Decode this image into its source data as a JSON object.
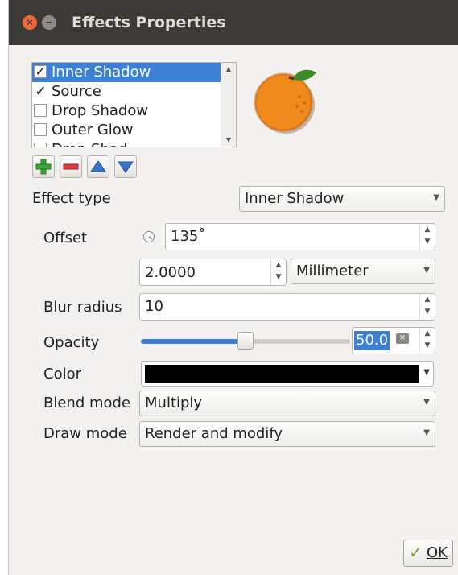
{
  "dialog": {
    "title": "Effects Properties"
  },
  "effects_list": {
    "items": [
      {
        "label": "Inner Shadow",
        "checked": true,
        "selected": true
      },
      {
        "label": "Source",
        "checked": true,
        "selected": false
      },
      {
        "label": "Drop Shadow",
        "checked": false,
        "selected": false
      },
      {
        "label": "Outer Glow",
        "checked": false,
        "selected": false
      },
      {
        "label": "Drop Shad",
        "checked": false,
        "selected": false
      }
    ]
  },
  "toolbar": {
    "icons": [
      "add-effect-icon",
      "remove-effect-icon",
      "move-up-icon",
      "move-down-icon"
    ]
  },
  "form": {
    "effect_type": {
      "label": "Effect type",
      "value": "Inner Shadow"
    },
    "offset": {
      "label": "Offset",
      "angle": "135˚",
      "distance": "2.0000",
      "unit": "Millimeter"
    },
    "blur_radius": {
      "label": "Blur radius",
      "value": "10"
    },
    "opacity": {
      "label": "Opacity",
      "value": "50.0",
      "level_percent": 50
    },
    "color": {
      "label": "Color",
      "value": "#000000"
    },
    "blend_mode": {
      "label": "Blend mode",
      "value": "Multiply"
    },
    "draw_mode": {
      "label": "Draw mode",
      "value": "Render and modify"
    }
  },
  "buttons": {
    "ok": "OK"
  },
  "colors": {
    "accent": "#3d7fd3",
    "titlebar": "#3b3a36",
    "close": "#f2673b"
  }
}
